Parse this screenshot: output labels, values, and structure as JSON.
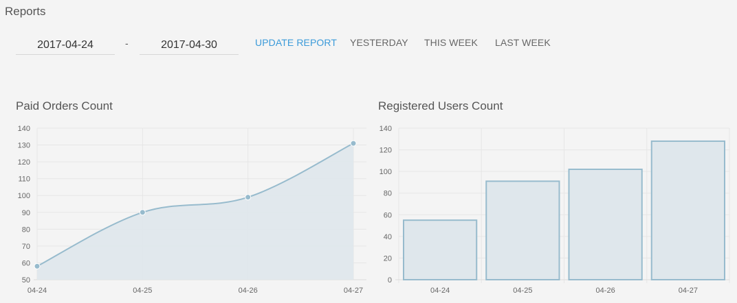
{
  "page": {
    "title": "Reports"
  },
  "filters": {
    "start_date": "2017-04-24",
    "separator": "-",
    "end_date": "2017-04-30",
    "update_label": "UPDATE REPORT",
    "yesterday_label": "YESTERDAY",
    "this_week_label": "THIS WEEK",
    "last_week_label": "LAST WEEK"
  },
  "colors": {
    "accent": "#3a9ad9",
    "series_line": "#97bbcd",
    "series_fill": "#dfe7ec"
  },
  "chart_data": [
    {
      "type": "line",
      "title": "Paid Orders Count",
      "categories": [
        "04-24",
        "04-25",
        "04-26",
        "04-27"
      ],
      "values": [
        58,
        90,
        99,
        131
      ],
      "ylim": [
        50,
        140
      ],
      "yticks": [
        50,
        60,
        70,
        80,
        90,
        100,
        110,
        120,
        130,
        140
      ],
      "grid": true,
      "fill": true
    },
    {
      "type": "bar",
      "title": "Registered Users Count",
      "categories": [
        "04-24",
        "04-25",
        "04-26",
        "04-27"
      ],
      "values": [
        55,
        91,
        102,
        128
      ],
      "ylim": [
        0,
        140
      ],
      "yticks": [
        0,
        20,
        40,
        60,
        80,
        100,
        120,
        140
      ],
      "grid": true
    }
  ]
}
